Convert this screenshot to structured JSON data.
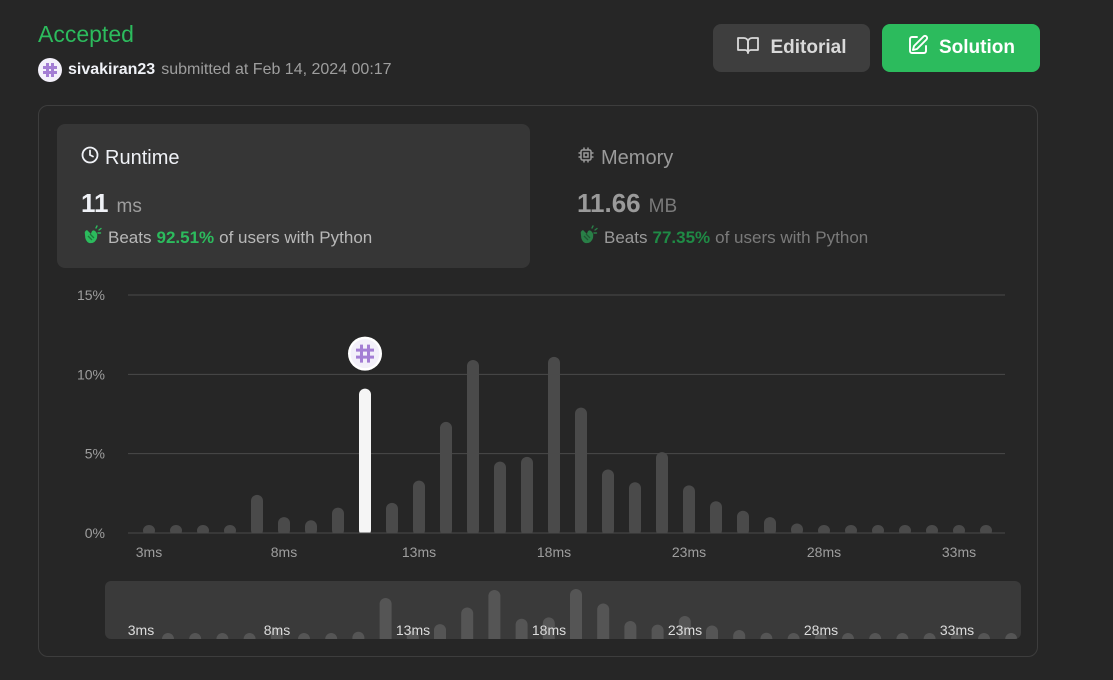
{
  "header": {
    "status": "Accepted",
    "username": "sivakiran23",
    "submitted_text": "submitted at Feb 14, 2024 00:17"
  },
  "buttons": {
    "editorial_label": "Editorial",
    "solution_label": "Solution"
  },
  "runtime": {
    "title": "Runtime",
    "value": "11",
    "unit": "ms",
    "beats_label": "Beats",
    "beats_pct": "92.51%",
    "beats_suffix": "of users with Python"
  },
  "memory": {
    "title": "Memory",
    "value": "11.66",
    "unit": "MB",
    "beats_label": "Beats",
    "beats_pct": "77.35%",
    "beats_suffix": "of users with Python"
  },
  "colors": {
    "accent": "#2cbb5d",
    "bar": "#4a4a4a",
    "highlight_bar": "#f5f5f5"
  },
  "chart_data": {
    "type": "bar",
    "xlabel": "",
    "ylabel": "",
    "ylim": [
      0,
      15
    ],
    "yticks": [
      "15%",
      "10%",
      "5%",
      "0%"
    ],
    "ytick_values": [
      15,
      10,
      5,
      0
    ],
    "xticks": [
      "3ms",
      "8ms",
      "13ms",
      "18ms",
      "23ms",
      "33ms",
      "28ms"
    ],
    "xtick_values": [
      3,
      8,
      13,
      18,
      23,
      33,
      28
    ],
    "categories": [
      3,
      4,
      5,
      6,
      7,
      8,
      9,
      10,
      11,
      12,
      13,
      14,
      15,
      16,
      17,
      18,
      19,
      20,
      21,
      22,
      23,
      24,
      25,
      26,
      27,
      28,
      29,
      30,
      31,
      32,
      33,
      34
    ],
    "values": [
      0.3,
      0.3,
      0.3,
      0.3,
      2.4,
      1.0,
      0.8,
      1.6,
      9.1,
      1.9,
      3.3,
      7.0,
      10.9,
      4.5,
      4.8,
      11.1,
      7.9,
      4.0,
      3.2,
      5.1,
      3.0,
      2.0,
      1.4,
      1.0,
      0.6,
      0.3,
      0.3,
      0.5,
      0.4,
      0.3,
      0.3,
      0.3
    ],
    "highlight": 11,
    "grid": true
  }
}
